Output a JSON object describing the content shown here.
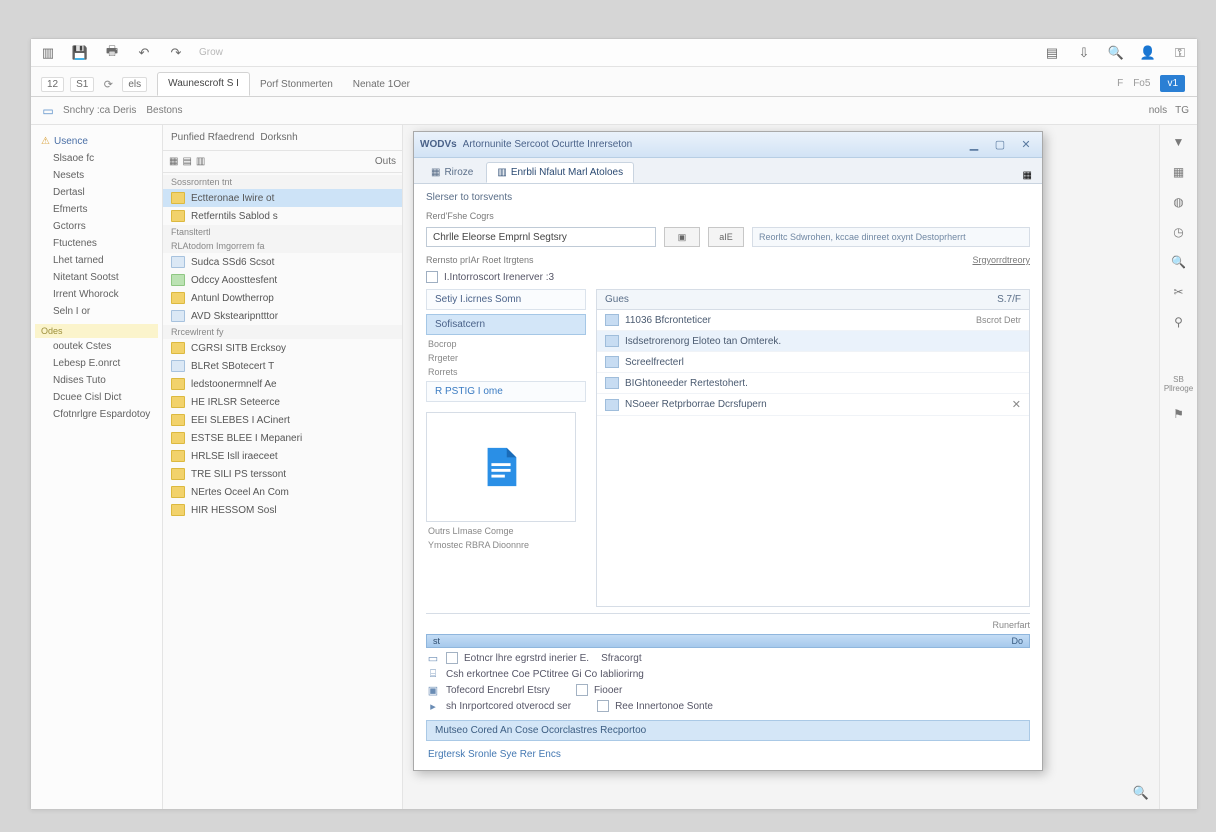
{
  "toolbar": {
    "hint": "Grow"
  },
  "quick": {
    "b1": "12",
    "b2": "S1",
    "b4": "els"
  },
  "tabs": [
    {
      "label": "Waunescroft S I"
    },
    {
      "label": "Porf Stonmerten"
    },
    {
      "label": "Nenate 1Oer"
    }
  ],
  "right_tools": {
    "a": "F",
    "b": "Fo5",
    "accent": "v1",
    "sub1": "nols",
    "sub2": "TG"
  },
  "ribbon": {
    "g1": "Snchry :ca Deris",
    "g2": "Bestons"
  },
  "nav": {
    "head": "Usence",
    "items": [
      "Slsaoe fc",
      "Nesets",
      "Dertasl",
      "Efmerts",
      "Gctorrs",
      "Ftuctenes",
      "Lhet tarned",
      "Nitetant Sootst",
      "Irrent Whorock",
      "Seln I or"
    ],
    "group_label": "Odes",
    "items2": [
      "ooutek Cstes",
      "Lebesp E.onrct",
      "Ndises Tuto",
      "Dcuee Cisl Dict",
      "Cfotnrlgre Espardotoy"
    ]
  },
  "list": {
    "head1": "Punfied Rfaedrend",
    "head2": "Dorksnh",
    "tab": "Outs",
    "rows": [
      {
        "t": "sec",
        "label": "Sossrornten tnt"
      },
      {
        "t": "sel",
        "label": "Ectteronae Iwire ot"
      },
      {
        "t": "row",
        "label": "Retferntils Sablod s"
      },
      {
        "t": "sec",
        "label": "Ftansltertl"
      },
      {
        "t": "sec",
        "label": "RLAtodom Imgorrem fa"
      },
      {
        "t": "row",
        "label": "Sudca SSd6 Scsot"
      },
      {
        "t": "row",
        "label": "Odccy Aoosttesfent"
      },
      {
        "t": "row",
        "label": "Antunl Dowtherrop"
      },
      {
        "t": "row",
        "label": "AVD Skstearipntttor"
      },
      {
        "t": "sec",
        "label": "Rrcewlrent fy"
      },
      {
        "t": "row",
        "label": "CGRSI SITB Ercksoy"
      },
      {
        "t": "row",
        "label": "BLRet SBotecert T"
      },
      {
        "t": "row",
        "label": "ledstoonermnelf Ae"
      },
      {
        "t": "row",
        "label": "HE IRLSR Seteerce"
      },
      {
        "t": "row",
        "label": "EEI SLEBES I ACinert"
      },
      {
        "t": "row",
        "label": "ESTSE BLEE I Mepaneri"
      },
      {
        "t": "row",
        "label": "HRLSE Isll iraeceet"
      },
      {
        "t": "row",
        "label": "TRE SILI PS terssont"
      },
      {
        "t": "row",
        "label": "NErtes Oceel An Com"
      },
      {
        "t": "row",
        "label": "HIR HESSOM Sosl"
      }
    ]
  },
  "dialog": {
    "title_prefix": "WODVs",
    "title": "Artornunite Sercoot Ocurtte Inrerseton",
    "tabs": [
      {
        "label": "Riroze",
        "active": false
      },
      {
        "label": "Enrbli Nfalut Marl Atoloes",
        "active": true
      }
    ],
    "section1": "Slerser to torsvents",
    "field1_label": "Rerd'Fshe Cogrs",
    "field1_value": "Chrlle Eleorse Emprnl Segtsry",
    "btn_small": "aIE",
    "side_note": "Reorltc Sdwrohen, kccae dinreet oxynt Destoprherrt",
    "sub1": "Rernsto prIAr Roet Itrgtens",
    "sub_r": "Srgyorrdtreory",
    "checkbox1": "I.Intorroscort Irenerver :3",
    "left": {
      "cat1": "Setiy I.icrnes Somn",
      "cat1_sub": "Sofisatcern",
      "gap_label": "Bocrop",
      "small1": "Rrgeter",
      "small2": "Rorrets",
      "recent": "R PSTIG I ome",
      "caption1": "Outrs LImase Comge",
      "caption2": "Ymostec RBRA Dioonnre"
    },
    "right": {
      "head_l": "Gues",
      "head_r": "S.7/F",
      "rows": [
        {
          "label": "11036 Bfcronteticer",
          "state": "plain",
          "meta": "Bscrot Detr"
        },
        {
          "label": "Isdsetrorenorg Eloteo tan Omterek.",
          "state": "hi"
        },
        {
          "label": "Screelfrecterl",
          "state": "plain"
        },
        {
          "label": "BIGhtoneeder Rertestohert.",
          "state": "plain"
        },
        {
          "label": "NSoeer Retprborrae Dcrsfupern",
          "state": "x"
        }
      ]
    },
    "lower": {
      "caption": "Runerfart",
      "progress_label": "st",
      "progress_right": "Do",
      "opt1_a": "Eotncr lhre egrstrd inerier E.",
      "opt1_b": "Sfracorgt",
      "opt2": "Csh erkortnee Coe PCtitree Gi Co Iabliorirng",
      "opt3_a": "Tofecord Encrebrl Etsry",
      "opt3_b": "Fiooer",
      "opt4_a": "sh Inrportcored otverocd ser",
      "opt4_b": "Ree Innertonoe Sonte",
      "banner": "Mutseo Cored An Cose Ocorclastres Recportoo",
      "footer_link": "Ergtersk Sronle Sye Rer Encs"
    }
  },
  "rail": {
    "lbl1": "SB Pllreoge"
  }
}
